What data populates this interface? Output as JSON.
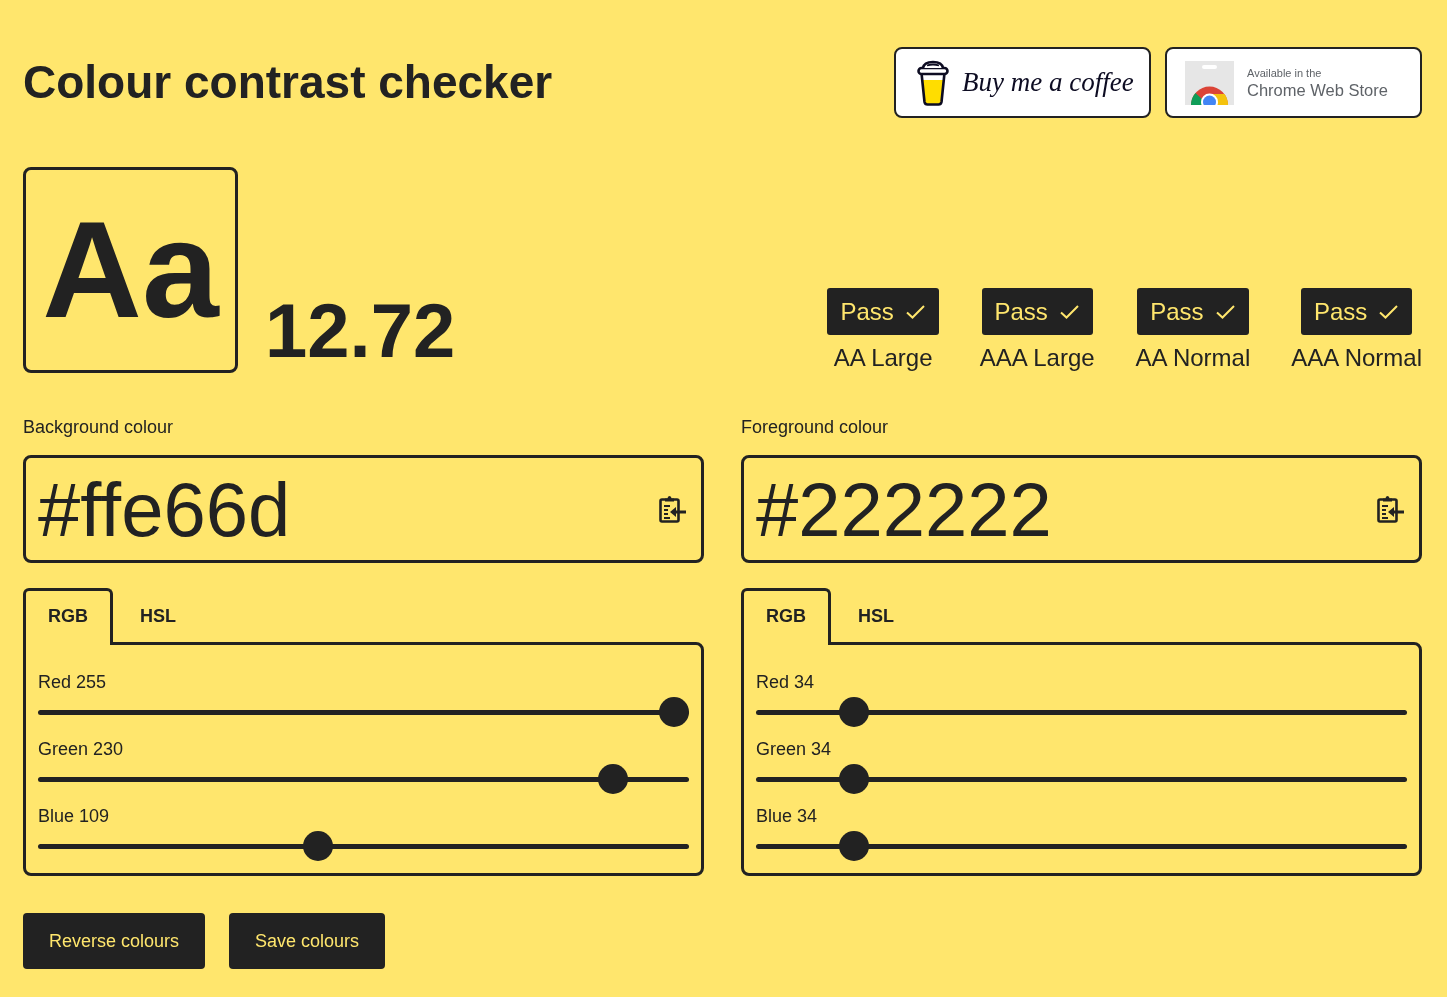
{
  "header": {
    "title": "Colour contrast checker",
    "links": [
      {
        "kind": "coffee",
        "label": "Buy me a coffee"
      },
      {
        "kind": "web-store",
        "caption": "Available in the",
        "label": "Chrome Web Store"
      }
    ]
  },
  "preview": {
    "sample": "Aa",
    "ratio": "12.72"
  },
  "results": [
    {
      "status": "Pass",
      "passed": true,
      "label": "AA Large"
    },
    {
      "status": "Pass",
      "passed": true,
      "label": "AAA Large"
    },
    {
      "status": "Pass",
      "passed": true,
      "label": "AA Normal"
    },
    {
      "status": "Pass",
      "passed": true,
      "label": "AAA Normal"
    }
  ],
  "colours": [
    {
      "label": "Background colour",
      "value": "#ffe66d",
      "tabs": [
        {
          "label": "RGB",
          "selected": true
        },
        {
          "label": "HSL",
          "selected": false
        }
      ],
      "sliders": [
        {
          "label": "Red 255",
          "level": 1
        },
        {
          "label": "Green 230",
          "level": 0.902
        },
        {
          "label": "Blue 109",
          "level": 0.427
        }
      ]
    },
    {
      "label": "Foreground colour",
      "value": "#222222",
      "tabs": [
        {
          "label": "RGB",
          "selected": true
        },
        {
          "label": "HSL",
          "selected": false
        }
      ],
      "sliders": [
        {
          "label": "Red 34",
          "level": 0.133
        },
        {
          "label": "Green 34",
          "level": 0.133
        },
        {
          "label": "Blue 34",
          "level": 0.133
        }
      ]
    }
  ],
  "buttons": [
    "Reverse colours",
    "Save colours"
  ]
}
